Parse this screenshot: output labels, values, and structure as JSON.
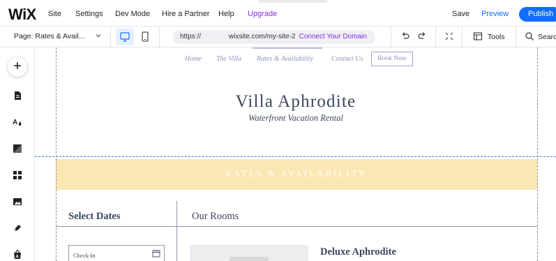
{
  "app": {
    "logo": "WiX",
    "menu": [
      "Site",
      "Settings",
      "Dev Mode",
      "Hire a Partner",
      "Help",
      "Upgrade"
    ],
    "save_label": "Save",
    "preview_label": "Preview",
    "publish_label": "Publish"
  },
  "toolbar": {
    "page_select": "Page: Rates & Avail...",
    "url_prefix": "https://",
    "url_domain": "wixsite.com/my-site-2",
    "connect_domain": "Connect Your Domain",
    "tools_label": "Tools",
    "search_label": "Search"
  },
  "leftbar": {
    "icons": [
      "add-icon",
      "pages-icon",
      "theme-icon",
      "background-icon",
      "apps-icon",
      "media-icon",
      "blog-icon",
      "store-icon"
    ]
  },
  "site": {
    "nav": [
      "Home",
      "The Villa",
      "Rates & Availability",
      "Contact Us"
    ],
    "book_now": "Book Now",
    "title": "Villa Aphrodite",
    "subtitle": "Waterfront Vacation Rental",
    "rates_band": "RATES & AVAILABILITY",
    "select_dates": "Select Dates",
    "our_rooms": "Our Rooms",
    "checkin_label": "Check-In",
    "room_name": "Deluxe Aphrodite"
  },
  "colors": {
    "accent": "#116dff",
    "upgrade": "#8a2be2",
    "band": "#fbe7b3",
    "site_text": "#3b475e",
    "nav_text": "#8b94b8"
  }
}
